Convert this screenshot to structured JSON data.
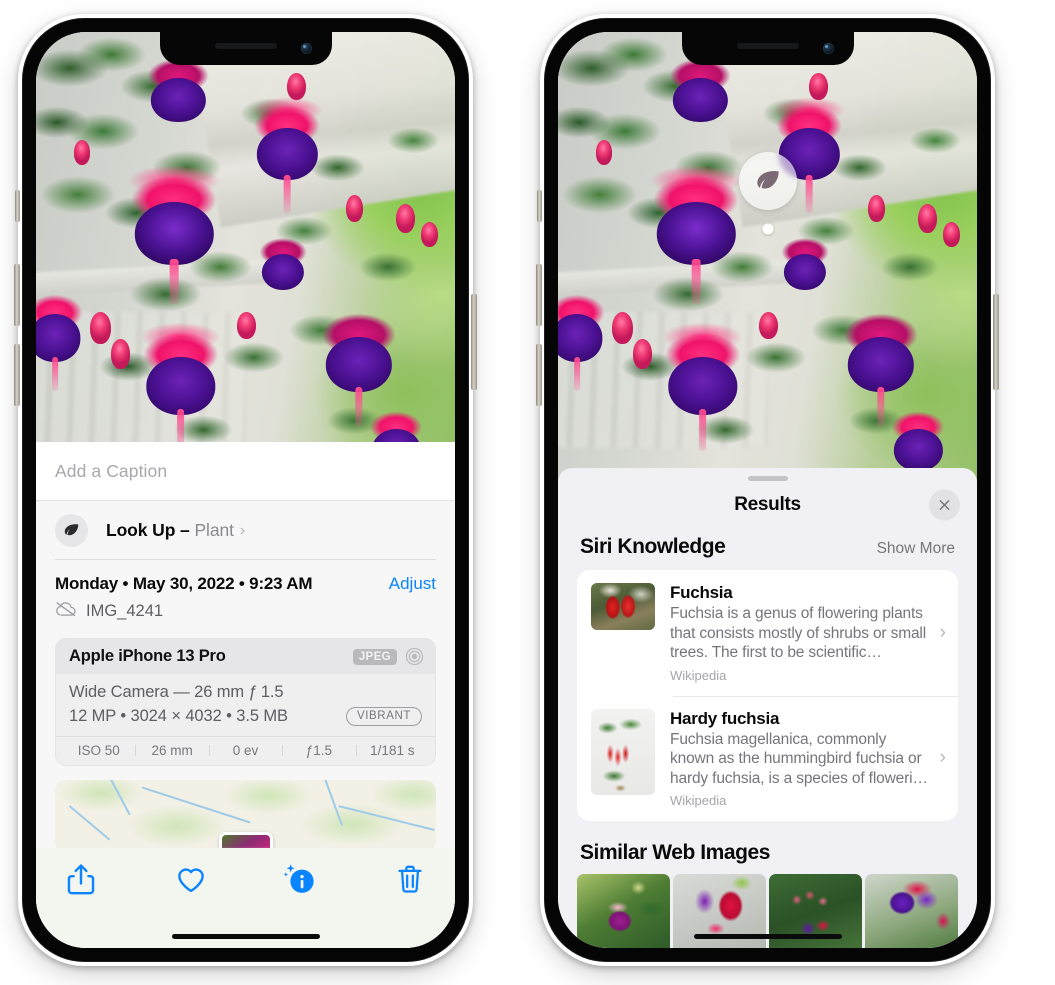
{
  "left_phone": {
    "caption_field": {
      "placeholder": "Add a Caption",
      "value": ""
    },
    "look_up": {
      "label": "Look Up – ",
      "subject": "Plant",
      "chevron": "›",
      "icon": "leaf-icon"
    },
    "metadata": {
      "date_line": "Monday • May 30, 2022 • 9:23 AM",
      "adjust_label": "Adjust",
      "filename": "IMG_4241",
      "cloud_icon": "cloud-slash-icon"
    },
    "camera_card": {
      "model": "Apple iPhone 13 Pro",
      "format_badge": "JPEG",
      "raw_icon": "aperture-icon",
      "lens_line": "Wide Camera — 26 mm ƒ 1.5",
      "size_line": "12 MP • 3024 × 4032 • 3.5 MB",
      "style_badge": "VIBRANT",
      "exif": [
        "ISO 50",
        "26 mm",
        "0 ev",
        "ƒ1.5",
        "1/181 s"
      ]
    },
    "map": {
      "name": "location-map-thumbnail"
    },
    "toolbar": [
      {
        "name": "share-button",
        "icon": "share-icon"
      },
      {
        "name": "favorite-button",
        "icon": "heart-icon"
      },
      {
        "name": "info-button",
        "icon": "info-sparkle-icon"
      },
      {
        "name": "delete-button",
        "icon": "trash-icon"
      }
    ]
  },
  "right_phone": {
    "visual_lookup_badge": {
      "icon": "leaf-icon"
    },
    "results_sheet": {
      "title": "Results",
      "close_label": "✕",
      "siri_section": {
        "title": "Siri Knowledge",
        "show_more": "Show More"
      },
      "knowledge_items": [
        {
          "title": "Fuchsia",
          "description": "Fuchsia is a genus of flowering plants that consists mostly of shrubs or small trees. The first to be scientific…",
          "source": "Wikipedia",
          "chevron": "›"
        },
        {
          "title": "Hardy fuchsia",
          "description": "Fuchsia magellanica, commonly known as the hummingbird fuchsia or hardy fuchsia, is a species of floweri…",
          "source": "Wikipedia",
          "chevron": "›"
        }
      ],
      "similar_section": {
        "title": "Similar Web Images",
        "count": 4
      }
    }
  },
  "colors": {
    "accent_blue": "#0a84ff",
    "sheet_bg": "#f1f1f5",
    "card_bg": "#ffffff",
    "secondary_text": "#75757b"
  }
}
